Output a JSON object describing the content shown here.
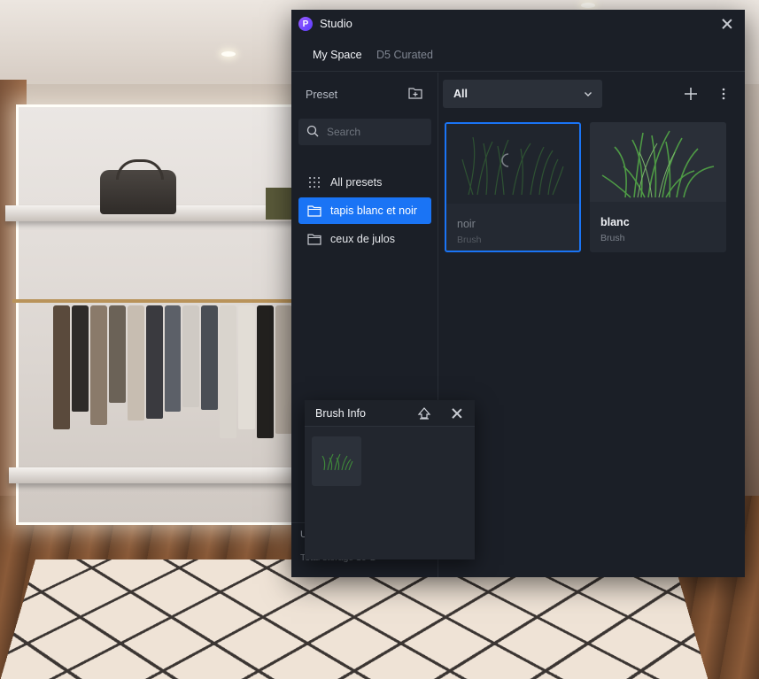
{
  "app": {
    "title": "Studio",
    "logo_letter": "P"
  },
  "tabs": [
    {
      "label": "My Space",
      "active": true
    },
    {
      "label": "D5 Curated",
      "active": false
    }
  ],
  "sidebar": {
    "header": "Preset",
    "search_placeholder": "Search",
    "items": [
      {
        "label": "All presets",
        "icon": "grid-dots-icon",
        "selected": false
      },
      {
        "label": "tapis blanc et noir",
        "icon": "folder-icon",
        "selected": true
      },
      {
        "label": "ceux de julos",
        "icon": "folder-icon",
        "selected": false
      }
    ],
    "footer": {
      "usage_label": "U",
      "total_storage": "Total storage 10 G"
    }
  },
  "main": {
    "filter": {
      "value": "All"
    },
    "cards": [
      {
        "name": "noir",
        "type": "Brush",
        "selected": true,
        "loading": true
      },
      {
        "name": "blanc",
        "type": "Brush",
        "selected": false,
        "loading": false
      }
    ]
  },
  "brush_info": {
    "title": "Brush Info"
  },
  "colors": {
    "accent": "#1a74f5",
    "panel": "#1b1f27",
    "grass": "#3f8a3a"
  }
}
